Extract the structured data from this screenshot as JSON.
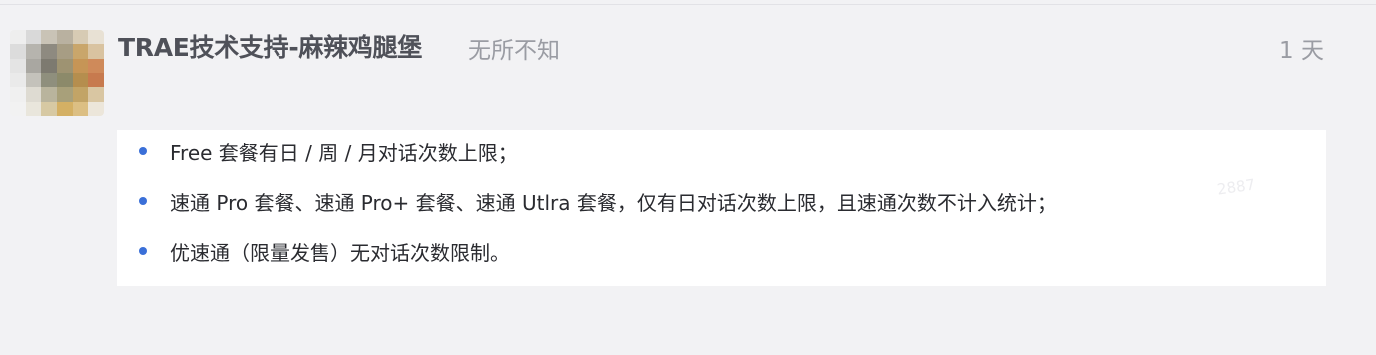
{
  "comment": {
    "author": "TRAE技术支持-麻辣鸡腿堡",
    "tag": "无所不知",
    "time": "1 天"
  },
  "content": {
    "items": [
      "Free 套餐有日 / 周 / 月对话次数上限；",
      "速通 Pro 套餐、速通 Pro+ 套餐、速通 Utlra 套餐，仅有日对话次数上限，且速通次数不计入统计；",
      "优速通（限量发售）无对话次数限制。"
    ]
  },
  "watermark": "2887",
  "colors": {
    "background": "#f2f2f4",
    "bullet": "#3a6fd8",
    "meta_text": "#9a9ca3",
    "author_text": "#4f5159"
  }
}
